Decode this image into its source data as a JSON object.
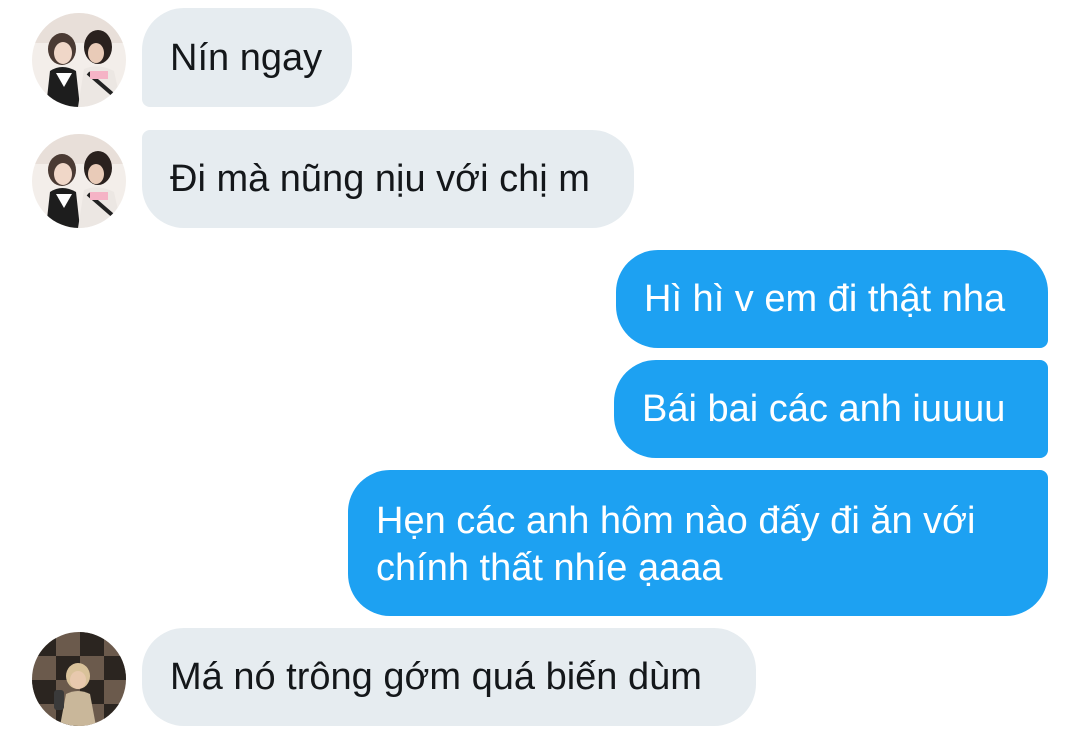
{
  "messages": [
    {
      "direction": "incoming",
      "text": "Nín ngay"
    },
    {
      "direction": "incoming",
      "text": "Đi mà nũng nịu với chị m"
    },
    {
      "direction": "outgoing",
      "text": "Hì hì v em đi thật nha"
    },
    {
      "direction": "outgoing",
      "text": "Bái bai các anh iuuuu"
    },
    {
      "direction": "outgoing",
      "text": "Hẹn các anh hôm nào đấy đi ăn với chính thất nhíe ạaaa"
    },
    {
      "direction": "incoming",
      "text": "Má nó trông gớm quá biến dùm"
    }
  ],
  "colors": {
    "incoming_bubble": "#e6ecf0",
    "outgoing_bubble": "#1da1f2",
    "incoming_text": "#14171a",
    "outgoing_text": "#ffffff",
    "background": "#ffffff"
  },
  "avatars": [
    {
      "icon": "user-photo-avatar"
    },
    {
      "icon": "user-photo-avatar"
    },
    {
      "icon": "user-photo-avatar-2"
    }
  ]
}
